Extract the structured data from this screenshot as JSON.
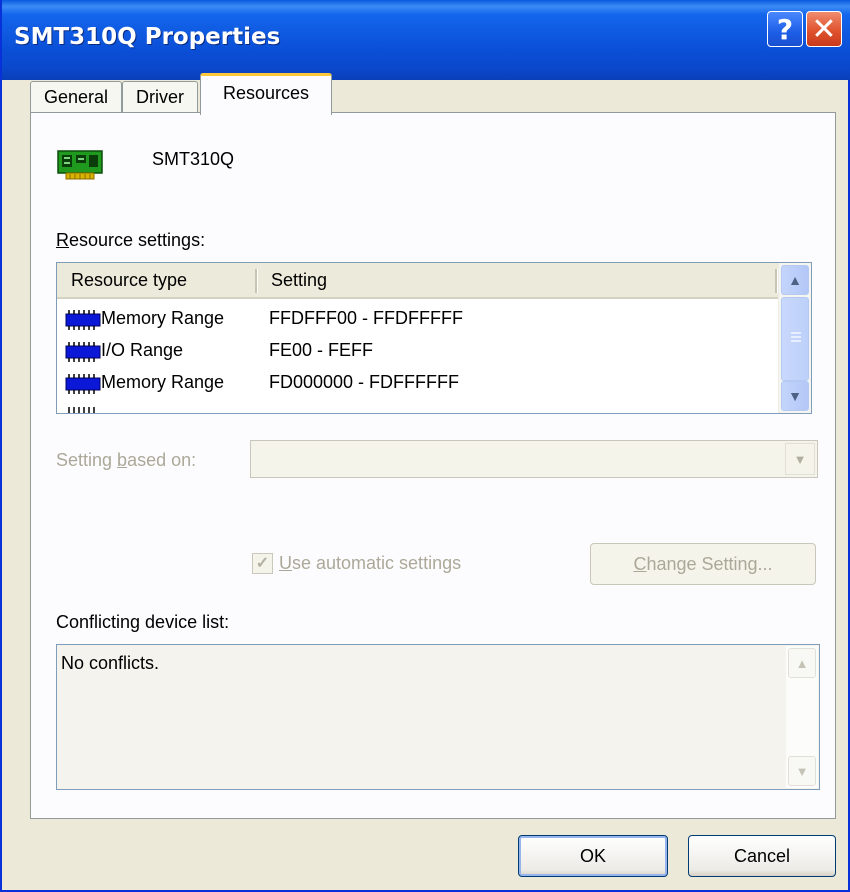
{
  "window": {
    "title": "SMT310Q Properties"
  },
  "titlebar": {
    "help_glyph": "?",
    "close_glyph": "✕"
  },
  "tabs": [
    {
      "label": "General",
      "active": false
    },
    {
      "label": "Driver",
      "active": false
    },
    {
      "label": "Resources",
      "active": true
    }
  ],
  "device": {
    "name": "SMT310Q",
    "icon": "pci-card-icon"
  },
  "resource_settings": {
    "label_access_key": "R",
    "label_rest": "esource settings:",
    "columns": [
      "Resource type",
      "Setting"
    ],
    "rows": [
      {
        "icon": "memory-chip-icon",
        "type": "Memory Range",
        "setting": "FFDFFF00 - FFDFFFFF"
      },
      {
        "icon": "memory-chip-icon",
        "type": "I/O Range",
        "setting": "FE00 - FEFF"
      },
      {
        "icon": "memory-chip-icon",
        "type": "Memory Range",
        "setting": "FD000000 - FDFFFFFF"
      }
    ]
  },
  "setting_based_on": {
    "label_pre": "Setting ",
    "label_access_key": "b",
    "label_post": "ased on:",
    "value": ""
  },
  "use_automatic": {
    "access_key": "U",
    "label_rest": "se automatic settings",
    "checked": true
  },
  "change_setting": {
    "access_key": "C",
    "label_rest": "hange Setting..."
  },
  "conflicts": {
    "label": "Conflicting device list:",
    "text": "No conflicts."
  },
  "buttons": {
    "ok": "OK",
    "cancel": "Cancel"
  },
  "colors": {
    "titlebar": "#0a4fd6",
    "window_bg": "#ece9d8",
    "panel_bg": "#fcfcfe",
    "tab_highlight": "#ffc73c",
    "chip_blue": "#0b18d8",
    "disabled_text": "#aca899"
  }
}
